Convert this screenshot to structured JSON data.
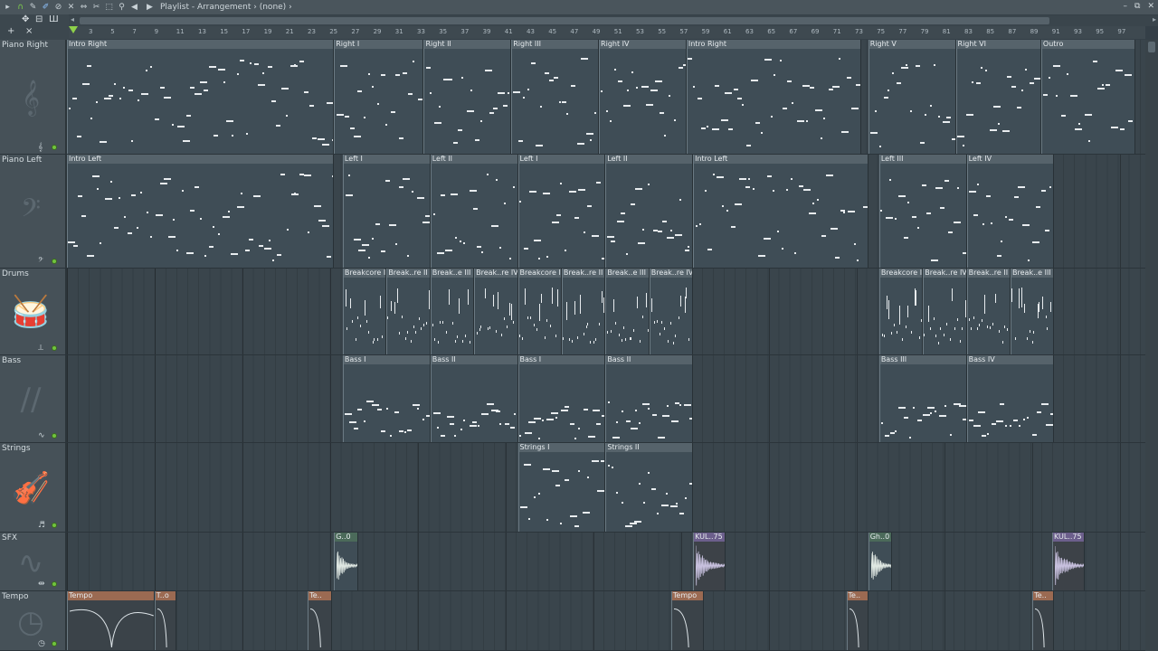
{
  "window": {
    "title_parts": [
      "Playlist",
      "Arrangement",
      "(none)"
    ],
    "sep1": " - ",
    "sep2": " › ",
    "arrow": "›"
  },
  "ruler": {
    "labels": [
      "3",
      "5",
      "7",
      "9",
      "11",
      "13",
      "15",
      "17",
      "19",
      "21",
      "23",
      "25",
      "27",
      "29",
      "31",
      "33",
      "35",
      "37",
      "39",
      "41",
      "43",
      "45",
      "47",
      "49",
      "51",
      "53",
      "55",
      "57",
      "59",
      "61",
      "63",
      "65",
      "67",
      "69",
      "71",
      "73",
      "75",
      "77",
      "79",
      "81",
      "83",
      "85",
      "87",
      "89",
      "91",
      "93",
      "95",
      "97"
    ]
  },
  "tracks": [
    {
      "id": "piano-right",
      "name": "Piano Right",
      "icon": "treble-clef-icon",
      "glyph": "𝄞",
      "small": "𝄞",
      "clips": [
        {
          "label": "Intro Right",
          "bar": 0,
          "len": 12.2
        },
        {
          "label": "Right I",
          "bar": 12.2,
          "len": 4.1
        },
        {
          "label": "Right II",
          "bar": 16.3,
          "len": 4
        },
        {
          "label": "Right III",
          "bar": 20.3,
          "len": 4
        },
        {
          "label": "Right IV",
          "bar": 24.3,
          "len": 4
        },
        {
          "label": "Intro Right",
          "bar": 28.3,
          "len": 8
        },
        {
          "label": "Right V",
          "bar": 36.6,
          "len": 4
        },
        {
          "label": "Right VI",
          "bar": 40.6,
          "len": 3.9
        },
        {
          "label": "Outro",
          "bar": 44.5,
          "len": 4.3
        }
      ]
    },
    {
      "id": "piano-left",
      "name": "Piano Left",
      "icon": "bass-clef-icon",
      "glyph": "𝄢",
      "small": "𝄢",
      "clips": [
        {
          "label": "Intro Left",
          "bar": 0,
          "len": 12.2
        },
        {
          "label": "Left I",
          "bar": 12.6,
          "len": 4
        },
        {
          "label": "Left II",
          "bar": 16.6,
          "len": 4
        },
        {
          "label": "Left I",
          "bar": 20.6,
          "len": 4
        },
        {
          "label": "Left II",
          "bar": 24.6,
          "len": 4
        },
        {
          "label": "Intro Left",
          "bar": 28.6,
          "len": 8
        },
        {
          "label": "Left III",
          "bar": 37.1,
          "len": 4
        },
        {
          "label": "Left IV",
          "bar": 41.1,
          "len": 4
        }
      ]
    },
    {
      "id": "drums",
      "name": "Drums",
      "icon": "drum-icon",
      "glyph": "🥁",
      "small": "⟂",
      "clips": [
        {
          "label": "Breakcore I",
          "bar": 12.6,
          "len": 2
        },
        {
          "label": "Break..re II",
          "bar": 14.6,
          "len": 2
        },
        {
          "label": "Break..e III",
          "bar": 16.6,
          "len": 2
        },
        {
          "label": "Break..re IV",
          "bar": 18.6,
          "len": 2
        },
        {
          "label": "Breakcore I",
          "bar": 20.6,
          "len": 2
        },
        {
          "label": "Break..re II",
          "bar": 22.6,
          "len": 2
        },
        {
          "label": "Break..e III",
          "bar": 24.6,
          "len": 2
        },
        {
          "label": "Break..re IV",
          "bar": 26.6,
          "len": 2
        },
        {
          "label": "Breakcore I",
          "bar": 37.1,
          "len": 2
        },
        {
          "label": "Break..re IV",
          "bar": 39.1,
          "len": 2
        },
        {
          "label": "Break..re II",
          "bar": 41.1,
          "len": 2
        },
        {
          "label": "Break..e III",
          "bar": 43.1,
          "len": 2
        }
      ]
    },
    {
      "id": "bass",
      "name": "Bass",
      "icon": "bass-wave-icon",
      "glyph": "∕∕",
      "small": "∿",
      "clips": [
        {
          "label": "Bass I",
          "bar": 12.6,
          "len": 4
        },
        {
          "label": "Bass II",
          "bar": 16.6,
          "len": 4
        },
        {
          "label": "Bass I",
          "bar": 20.6,
          "len": 4
        },
        {
          "label": "Bass II",
          "bar": 24.6,
          "len": 4
        },
        {
          "label": "Bass III",
          "bar": 37.1,
          "len": 4
        },
        {
          "label": "Bass IV",
          "bar": 41.1,
          "len": 4
        }
      ]
    },
    {
      "id": "strings",
      "name": "Strings",
      "icon": "violin-icon",
      "glyph": "🎻",
      "small": "♬",
      "clips": [
        {
          "label": "Strings I",
          "bar": 20.6,
          "len": 4
        },
        {
          "label": "Strings II",
          "bar": 24.6,
          "len": 4
        }
      ]
    },
    {
      "id": "sfx",
      "name": "SFX",
      "icon": "waveform-icon",
      "glyph": "∿",
      "small": "⇹",
      "clips": [
        {
          "label": "G..0",
          "bar": 12.2,
          "len": 1.1,
          "kind": "sfx1"
        },
        {
          "label": "KUL..75",
          "bar": 28.6,
          "len": 1.5,
          "kind": "audio"
        },
        {
          "label": "Gh..0",
          "bar": 36.6,
          "len": 1.1,
          "kind": "sfx1"
        },
        {
          "label": "KUL..75",
          "bar": 45,
          "len": 1.5,
          "kind": "audio"
        }
      ]
    },
    {
      "id": "tempo",
      "name": "Tempo",
      "icon": "clock-icon",
      "glyph": "◷",
      "small": "◷",
      "clips": [
        {
          "label": "Tempo",
          "bar": 0,
          "len": 4,
          "kind": "auto"
        },
        {
          "label": "T..o",
          "bar": 4,
          "len": 1,
          "kind": "auto"
        },
        {
          "label": "Te..",
          "bar": 11,
          "len": 1.1,
          "kind": "auto"
        },
        {
          "label": "Tempo",
          "bar": 27.6,
          "len": 1.5,
          "kind": "auto"
        },
        {
          "label": "Te..",
          "bar": 35.6,
          "len": 1,
          "kind": "auto"
        },
        {
          "label": "Te..",
          "bar": 44.1,
          "len": 1,
          "kind": "auto"
        }
      ]
    }
  ]
}
